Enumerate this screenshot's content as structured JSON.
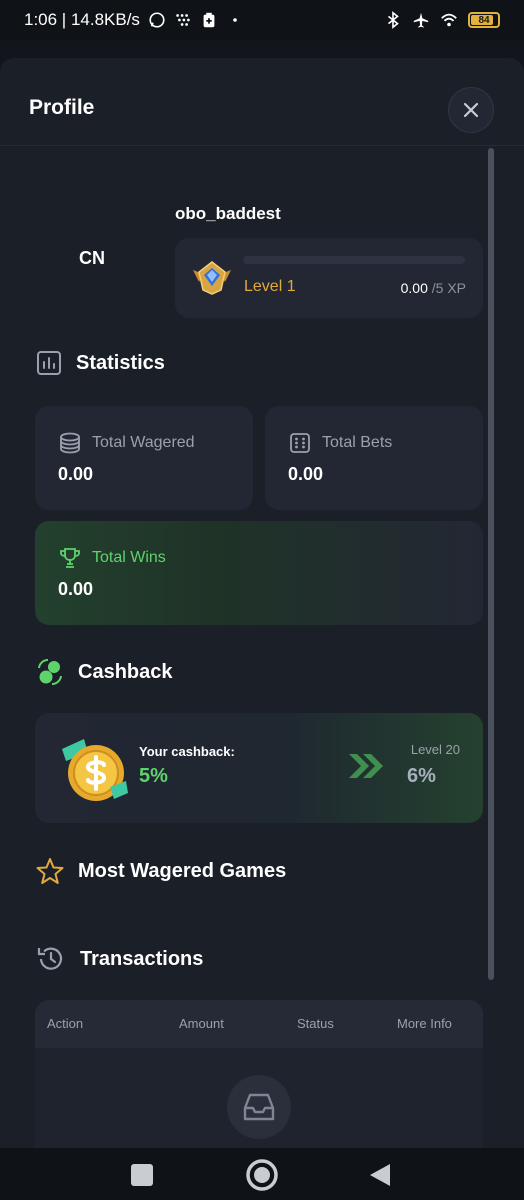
{
  "status_bar": {
    "time_speed": "1:06 | 14.8KB/s",
    "battery": "84",
    "icons": [
      "whatsapp-icon",
      "grid-icon",
      "battery-saver-icon",
      "dot-icon",
      "bluetooth-icon",
      "airplane-icon",
      "wifi-icon",
      "battery-icon"
    ]
  },
  "header": {
    "title": "Profile",
    "close_icon": "close-icon"
  },
  "user": {
    "initials": "CN",
    "username": "obo_baddest",
    "level": "Level 1",
    "xp_current": "0.00",
    "xp_total": "/5 XP",
    "xp_progress": 0
  },
  "statistics": {
    "title": "Statistics",
    "icon": "bar-chart-icon",
    "total_wagered": {
      "label": "Total Wagered",
      "value": "0.00",
      "icon": "coins-icon"
    },
    "total_bets": {
      "label": "Total Bets",
      "value": "0.00",
      "icon": "dice-icon"
    },
    "total_wins": {
      "label": "Total Wins",
      "value": "0.00",
      "icon": "trophy-icon"
    }
  },
  "cashback": {
    "title": "Cashback",
    "icon": "cashback-icon",
    "your_label": "Your cashback:",
    "your_value": "5%",
    "next_level_label": "Level 20",
    "next_level_value": "6%"
  },
  "most_wagered": {
    "title": "Most Wagered Games",
    "icon": "star-icon"
  },
  "transactions": {
    "title": "Transactions",
    "icon": "history-icon",
    "columns": [
      "Action",
      "Amount",
      "Status",
      "More Info"
    ],
    "empty_icon": "inbox-icon"
  },
  "colors": {
    "accent_green": "#5fd36b",
    "accent_gold": "#e2a93b",
    "panel_bg": "#1b1f27",
    "card_bg": "#232734"
  }
}
